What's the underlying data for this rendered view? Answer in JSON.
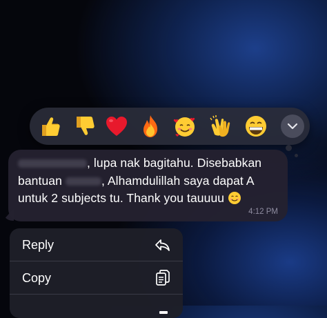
{
  "reactions": [
    {
      "icon": "thumbs-up-icon"
    },
    {
      "icon": "thumbs-down-icon"
    },
    {
      "icon": "heart-icon"
    },
    {
      "icon": "fire-icon"
    },
    {
      "icon": "smiling-face-with-hearts-icon"
    },
    {
      "icon": "clapping-hands-icon"
    },
    {
      "icon": "grinning-face-icon"
    }
  ],
  "message": {
    "line1_text": ", lupa nak bagitahu. Disebabkan",
    "line2_prefix": "bantuan",
    "line2_suffix": ", Alhamdulillah saya dapat A",
    "line3_text": "untuk 2 subjects tu. Thank you tauuuu",
    "inline_emoji": "smiling-face-icon",
    "timestamp": "4:12 PM"
  },
  "menu": {
    "items": [
      {
        "label": "Reply",
        "icon": "reply-arrow-icon"
      },
      {
        "label": "Copy",
        "icon": "copy-icon"
      }
    ]
  },
  "colors": {
    "bubble": "#242130",
    "reaction_bar": "#2a2c3a",
    "menu_bg": "#1e1f28",
    "timestamp": "#8f8da0"
  }
}
